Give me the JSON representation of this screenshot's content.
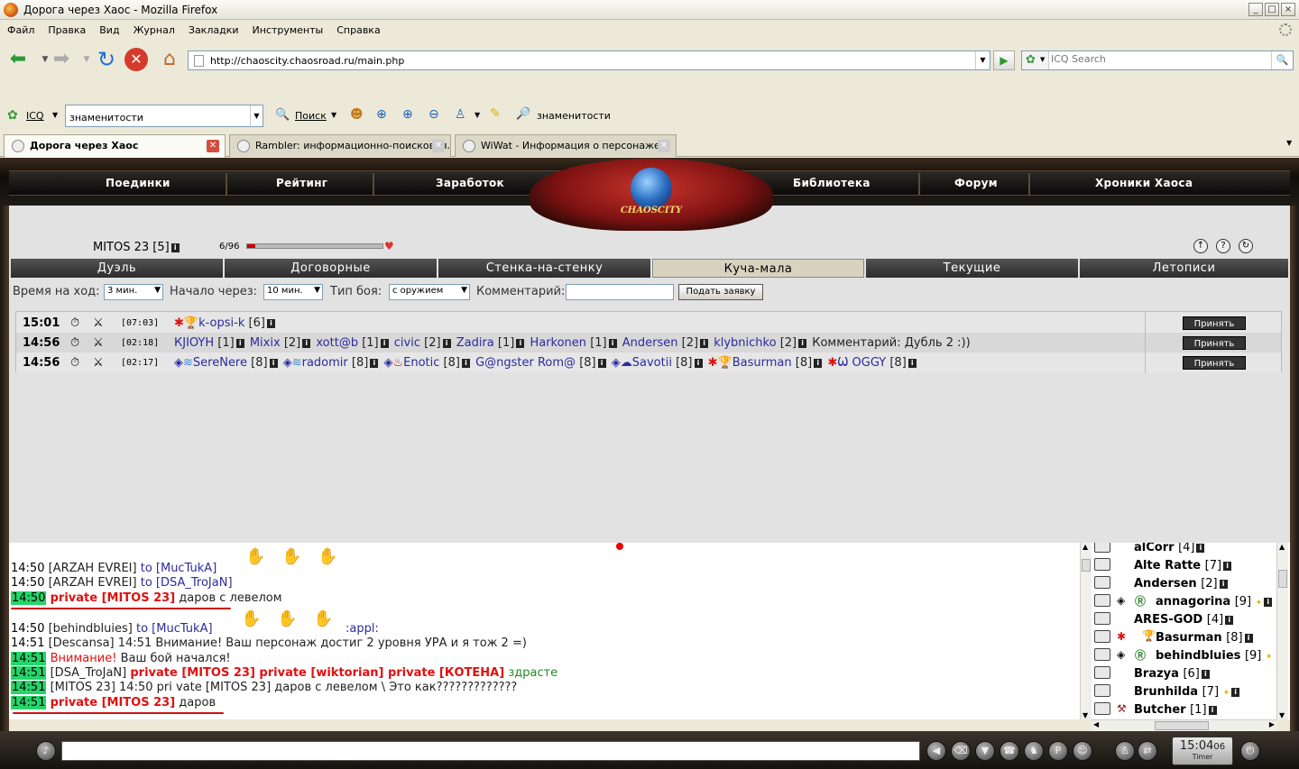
{
  "window": {
    "title": "Дорога через Хаос - Mozilla Firefox",
    "buttons": [
      "_",
      "□",
      "×"
    ]
  },
  "menu": [
    "Файл",
    "Правка",
    "Вид",
    "Журнал",
    "Закладки",
    "Инструменты",
    "Справка"
  ],
  "nav": {
    "url": "http://chaoscity.chaosroad.ru/main.php",
    "search_placeholder": "ICQ Search"
  },
  "icq_toolbar": {
    "icq_label": "ICQ",
    "search_value": "знаменитости",
    "search_button": "Поиск",
    "highlight_label": "знаменитости"
  },
  "tabs": [
    {
      "label": "Дорога через Хаос",
      "active": true
    },
    {
      "label": "Rambler: информационно-поисковая...",
      "active": false
    },
    {
      "label": "WiWat - Информация о персонаже",
      "active": false
    }
  ],
  "game_nav": [
    "Поединки",
    "Рейтинг",
    "Заработок",
    "Библиотека",
    "Форум",
    "Хроники Хаоса"
  ],
  "logo_text": "CHAOSCITY",
  "player": {
    "name": "MITOS 23",
    "level": "[5]",
    "hp": "6/96",
    "hp_fraction": 0.0625
  },
  "fight_tabs": [
    "Дуэль",
    "Договорные",
    "Стенка-на-стенку",
    "Куча-мала",
    "Текущие",
    "Летописи"
  ],
  "active_fight_tab": "Куча-мала",
  "form": {
    "turn_time_label": "Время на ход:",
    "turn_time": "3 мин.",
    "start_label": "Начало через:",
    "start": "10 мин.",
    "type_label": "Тип боя:",
    "type": "с оружием",
    "comment_label": "Комментарий:",
    "submit": "Подать заявку"
  },
  "fights": [
    {
      "time": "15:01",
      "duration": "[07:03]",
      "accept": "Принять"
    },
    {
      "time": "14:56",
      "duration": "[02:18]",
      "accept": "Принять",
      "comment": "Комментарий: Дубль 2 :))"
    },
    {
      "time": "14:56",
      "duration": "[02:17]",
      "accept": "Принять"
    }
  ],
  "fight1_players": {
    "p1": "k-opsi-k",
    "l1": "[6]"
  },
  "fight2_players": {
    "p1": "КЈIOYH",
    "l1": "[1]",
    "p2": "Mixix",
    "l2": "[2]",
    "p3": "xott@b",
    "l3": "[1]",
    "p4": "civic",
    "l4": "[2]",
    "p5": "Zadira",
    "l5": "[1]",
    "p6": "Harkonen",
    "l6": "[1]",
    "p7": "Andersen",
    "l7": "[2]",
    "p8": "klybnichko",
    "l8": "[2]"
  },
  "fight3_players": {
    "p1": "SereNere",
    "l1": "[8]",
    "p2": "radomir",
    "l2": "[8]",
    "p3": "Enotic",
    "l3": "[8]",
    "p4": "G@ngster Rom@",
    "l4": "[8]",
    "p5": "Savotii",
    "l5": "[8]",
    "p6": "Basurman",
    "l6": "[8]",
    "p7": "OGGY",
    "l7": "[8]"
  },
  "chat": {
    "l1": {
      "ts": "14:50",
      "from": "[ARZAH EVREI]",
      "to": "to [MucTukA]"
    },
    "l2": {
      "ts": "14:50",
      "from": "[ARZAH EVREI]",
      "to": "to [DSA_TroJaN]"
    },
    "l3": {
      "ts": "14:50",
      "pr": "private [MITOS 23]",
      "msg": "даров с левелом"
    },
    "l4": {
      "ts": "14:50",
      "from": "[behindbluies]",
      "to": "to [MucTukA]",
      "extra": ":appl:"
    },
    "l5": {
      "ts": "14:51",
      "msg": "[Descansa] 14:51 Внимание! Ваш персонаж достиг 2 уровня УРА и я тож 2 =)"
    },
    "l6": {
      "ts": "14:51",
      "warn": "Внимание!",
      "msg": "Ваш бой начался!"
    },
    "l7": {
      "ts": "14:51",
      "from": "[DSA_TroJaN]",
      "pr": "private [MITOS 23] private [wiktorian] private [КОТЕНА]",
      "msg": "здрасте"
    },
    "l8": {
      "ts": "14:51",
      "msg": "[MITOS 23] 14:50 pri vate [MITOS 23] даров с левелом \\ Это как?????????????"
    },
    "l9": {
      "ts": "14:51",
      "pr": "private [MITOS 23]",
      "msg": "даров"
    }
  },
  "users": [
    {
      "name": "alCorr",
      "level": "[4]"
    },
    {
      "name": "Alte Ratte",
      "level": "[7]"
    },
    {
      "name": "Andersen",
      "level": "[2]"
    },
    {
      "name": "annagorina",
      "level": "[9]"
    },
    {
      "name": "ARES-GOD",
      "level": "[4]"
    },
    {
      "name": "Basurman",
      "level": "[8]"
    },
    {
      "name": "behindbluies",
      "level": "[9]"
    },
    {
      "name": "Brazya",
      "level": "[6]"
    },
    {
      "name": "Brunhilda",
      "level": "[7]"
    },
    {
      "name": "Butcher",
      "level": "[1]"
    }
  ],
  "clock": {
    "time": "15:04",
    "seconds": "06",
    "label": "Timer"
  }
}
